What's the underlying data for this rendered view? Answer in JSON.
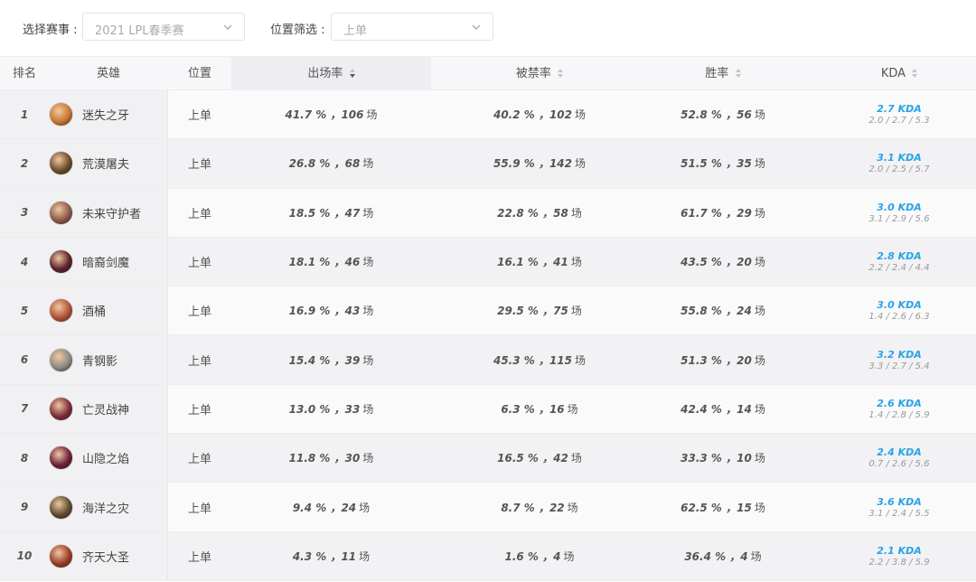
{
  "filters": {
    "event_label": "选择赛事 :",
    "event_value": "2021 LPL春季赛",
    "position_label": "位置筛选 :",
    "position_value": "上单"
  },
  "table": {
    "headers": {
      "rank": "排名",
      "hero": "英雄",
      "position": "位置",
      "pick_rate": "出场率",
      "ban_rate": "被禁率",
      "win_rate": "胜率",
      "kda": "KDA"
    },
    "sorted_by": "pick_rate",
    "sort_direction": "desc",
    "rows": [
      {
        "rank": "1",
        "hero": "迷失之牙",
        "position": "上单",
        "pick": "41.7 % ，106",
        "ban": "40.2 % ，102",
        "win": "52.8 % ，56",
        "kda": "2.7 KDA",
        "kda_detail": "2.0 / 2.7 / 5.3",
        "avatar_color": "#c9762f"
      },
      {
        "rank": "2",
        "hero": "荒漠屠夫",
        "position": "上单",
        "pick": "26.8 % ，68",
        "ban": "55.9 % ，142",
        "win": "51.5 % ，35",
        "kda": "3.1 KDA",
        "kda_detail": "2.0 / 2.5 / 5.7",
        "avatar_color": "#6b4a2a"
      },
      {
        "rank": "3",
        "hero": "未来守护者",
        "position": "上单",
        "pick": "18.5 % ，47",
        "ban": "22.8 % ，58",
        "win": "61.7 % ，29",
        "kda": "3.0 KDA",
        "kda_detail": "3.1 / 2.9 / 5.6",
        "avatar_color": "#8a5a4a"
      },
      {
        "rank": "4",
        "hero": "暗裔剑魔",
        "position": "上单",
        "pick": "18.1 % ，46",
        "ban": "16.1 % ，41",
        "win": "43.5 % ，20",
        "kda": "2.8 KDA",
        "kda_detail": "2.2 / 2.4 / 4.4",
        "avatar_color": "#5a1f2a"
      },
      {
        "rank": "5",
        "hero": "酒桶",
        "position": "上单",
        "pick": "16.9 % ，43",
        "ban": "29.5 % ，75",
        "win": "55.8 % ，24",
        "kda": "3.0 KDA",
        "kda_detail": "1.4 / 2.6 / 6.3",
        "avatar_color": "#b0503a"
      },
      {
        "rank": "6",
        "hero": "青钢影",
        "position": "上单",
        "pick": "15.4 % ，39",
        "ban": "45.3 % ，115",
        "win": "51.3 % ，20",
        "kda": "3.2 KDA",
        "kda_detail": "3.3 / 2.7 / 5.4",
        "avatar_color": "#8c8a84"
      },
      {
        "rank": "7",
        "hero": "亡灵战神",
        "position": "上单",
        "pick": "13.0 % ，33",
        "ban": "6.3 % ，16",
        "win": "42.4 % ，14",
        "kda": "2.6 KDA",
        "kda_detail": "1.4 / 2.8 / 5.9",
        "avatar_color": "#7a2a3a"
      },
      {
        "rank": "8",
        "hero": "山隐之焰",
        "position": "上单",
        "pick": "11.8 % ，30",
        "ban": "16.5 % ，42",
        "win": "33.3 % ，10",
        "kda": "2.4 KDA",
        "kda_detail": "0.7 / 2.6 / 5.6",
        "avatar_color": "#6a1f3a"
      },
      {
        "rank": "9",
        "hero": "海洋之灾",
        "position": "上单",
        "pick": "9.4 % ，24",
        "ban": "8.7 % ，22",
        "win": "62.5 % ，15",
        "kda": "3.6 KDA",
        "kda_detail": "3.1 / 2.4 / 5.5",
        "avatar_color": "#5a4a2f"
      },
      {
        "rank": "10",
        "hero": "齐天大圣",
        "position": "上单",
        "pick": "4.3 % ，11",
        "ban": "1.6 % ，4",
        "win": "36.4 % ，4",
        "kda": "2.1 KDA",
        "kda_detail": "2.2 / 3.8 / 5.9",
        "avatar_color": "#9a3a2a"
      }
    ],
    "unit": "场"
  },
  "colors": {
    "kda_accent": "#29a3e6"
  }
}
